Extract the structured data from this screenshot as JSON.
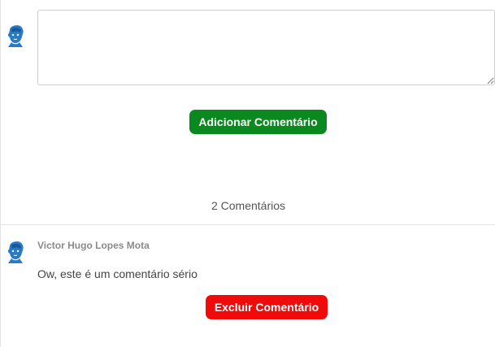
{
  "composer": {
    "input_value": "",
    "input_placeholder": "",
    "submit_label": "Adicionar Comentário"
  },
  "comments_header": {
    "count_label": "2 Comentários"
  },
  "comments": [
    {
      "author": "Victor Hugo Lopes Mota",
      "text": "Ow, este é um comentário sério",
      "delete_label": "Excluir Comentário",
      "avatar_icon": "user-avatar-icon"
    }
  ],
  "colors": {
    "add_button": "#0a8a1e",
    "delete_button": "#f00a0a",
    "avatar": "#2a7bc4"
  }
}
